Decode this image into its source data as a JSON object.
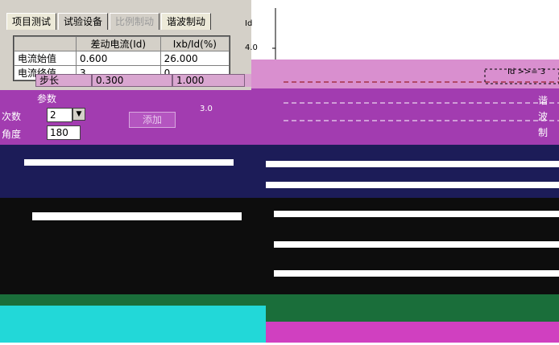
{
  "tabs": [
    {
      "label": "项目测试",
      "state": "active"
    },
    {
      "label": "试验设备",
      "state": "normal"
    },
    {
      "label": "比例制动",
      "state": "disabled"
    },
    {
      "label": "谐波制动",
      "state": "active"
    }
  ],
  "grid": {
    "headers": [
      "",
      "差动电流(Id)",
      "Ixb/Id(%)"
    ],
    "rows": [
      [
        "电流始值",
        "0.600",
        "26.000"
      ],
      [
        "电流终值",
        "3.",
        "0."
      ],
      [
        "步长",
        "0.300",
        "1.000"
      ]
    ]
  },
  "form": {
    "harmonic_label": "次数",
    "harmonic_value": "2",
    "phase_label": "角度",
    "phase_value": "180",
    "add_button": "添加",
    "param_label": "参数"
  },
  "chart": {
    "y_label": "Id",
    "ticks": [
      "4.0",
      "3.0"
    ],
    "legend_text": "Id >>= 3",
    "right_labels": [
      "谐",
      "波",
      "制"
    ]
  },
  "colors": {
    "panel": "#d4d0c8",
    "accent": "#a23cb0",
    "chart_line": "#8b0000"
  }
}
